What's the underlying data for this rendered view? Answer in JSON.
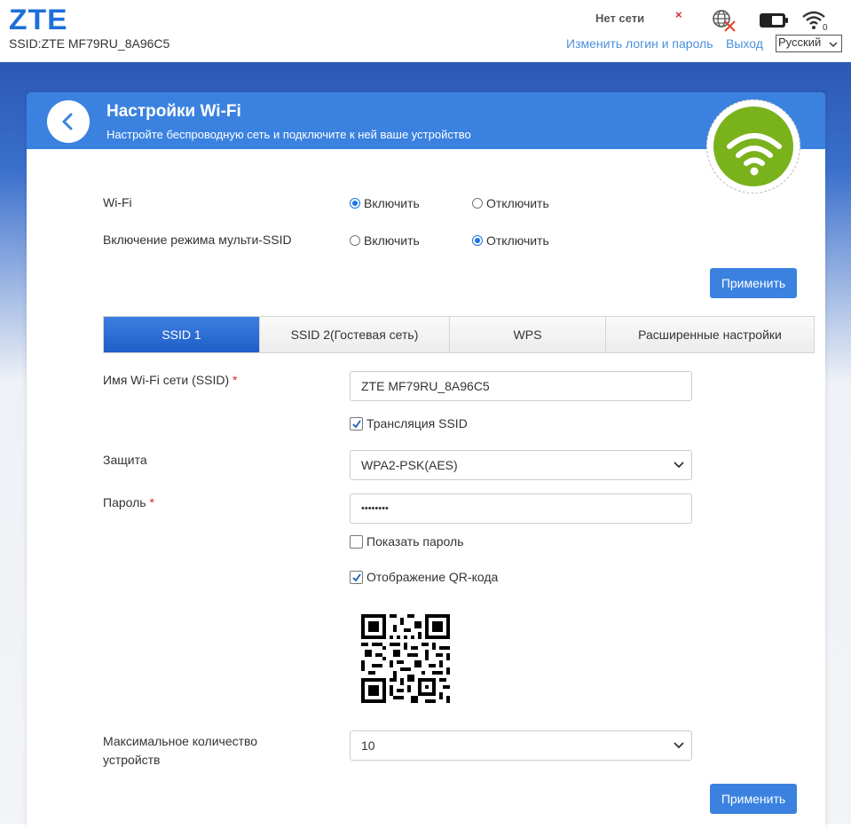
{
  "header": {
    "logo": "ZTE",
    "ssid_line": "SSID:ZTE MF79RU_8A96C5",
    "network_status": "Нет сети",
    "signal_mark": "×",
    "wifi_clients": "0",
    "change_login_link": "Изменить логин и пароль",
    "logout_link": "Выход",
    "language": "Русский"
  },
  "panel": {
    "title": "Настройки Wi-Fi",
    "subtitle": "Настройте беспроводную сеть и подключите к ней ваше устройство"
  },
  "wifi_toggle": {
    "label": "Wi-Fi",
    "enable": "Включить",
    "disable": "Отключить",
    "selected": "enable"
  },
  "multi_ssid": {
    "label": "Включение режима мульти-SSID",
    "enable": "Включить",
    "disable": "Отключить",
    "selected": "disable"
  },
  "apply_label": "Применить",
  "tabs": [
    {
      "label": "SSID 1",
      "active": true
    },
    {
      "label": "SSID 2(Гостевая сеть)",
      "active": false
    },
    {
      "label": "WPS",
      "active": false
    },
    {
      "label": "Расширенные настройки",
      "active": false
    }
  ],
  "form": {
    "ssid_label": "Имя Wi-Fi сети (SSID)",
    "ssid_value": "ZTE MF79RU_8A96C5",
    "broadcast_label": "Трансляция SSID",
    "broadcast_checked": true,
    "security_label": "Защита",
    "security_value": "WPA2-PSK(AES)",
    "password_label": "Пароль",
    "password_value": "••••••••",
    "show_password_label": "Показать пароль",
    "show_password_checked": false,
    "qr_label": "Отображение QR-кода",
    "qr_checked": true,
    "max_devices_label_1": "Максимальное количество",
    "max_devices_label_2": "устройств",
    "max_devices_value": "10",
    "required_mark": "*"
  },
  "colors": {
    "brand_blue": "#3b82e0",
    "wifi_green": "#7ab21c",
    "error_red": "#d62b2b"
  },
  "icons": [
    "back-arrow-icon",
    "wifi-icon",
    "globe-icon",
    "battery-icon",
    "chevron-down-icon",
    "checkmark-icon",
    "qr-code-icon"
  ]
}
